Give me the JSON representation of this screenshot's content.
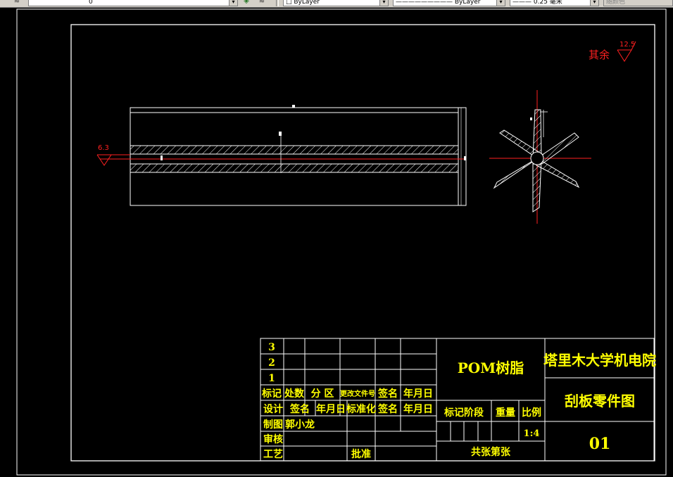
{
  "toolbar": {
    "layer_value": "0",
    "color_value": "ByLayer",
    "linetype_value": "ByLayer",
    "lineweight_value": "0.25 毫米",
    "plotstyle_value": "随颜色"
  },
  "drawing": {
    "roughness_default_label": "其余",
    "roughness_default_value": "12.5",
    "roughness_left_value": "6.3"
  },
  "title_block": {
    "rev_numbers": [
      "3",
      "2",
      "1"
    ],
    "rev_headers": [
      "标记",
      "处数",
      "分 区",
      "更改文件号",
      "签名",
      "年月日"
    ],
    "sign_row": [
      "设计",
      "签名",
      "年月日",
      "标准化",
      "签名",
      "年月日"
    ],
    "drawn_label": "制图",
    "drawn_name": "郭小龙",
    "review_label": "审核",
    "process_label": "工艺",
    "approve_label": "批准",
    "material": "POM树脂",
    "stage_label": "标记阶段",
    "weight_label": "重量",
    "scale_label": "比例",
    "scale_value": "1:4",
    "sheets_label": "共张第张",
    "organization": "塔里木大学机电院",
    "drawing_name": "刮板零件图",
    "drawing_number": "01"
  }
}
